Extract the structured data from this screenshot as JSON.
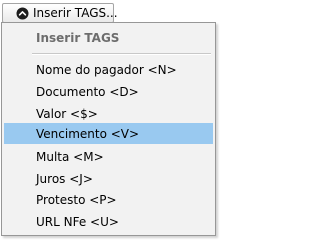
{
  "trigger": {
    "label": "Inserir TAGS...",
    "icon": "chevron-up-circle-icon"
  },
  "menu": {
    "header": "Inserir TAGS",
    "items": [
      {
        "label": "Nome do pagador <N>",
        "selected": false
      },
      {
        "label": "Documento <D>",
        "selected": false
      },
      {
        "label": "Valor <$>",
        "selected": false
      },
      {
        "label": "Vencimento <V>",
        "selected": true
      },
      {
        "label": "Multa <M>",
        "selected": false
      },
      {
        "label": "Juros <J>",
        "selected": false
      },
      {
        "label": "Protesto <P>",
        "selected": false
      },
      {
        "label": "URL NFe <U>",
        "selected": false
      }
    ]
  },
  "colors": {
    "selected_bg": "#99c9f0",
    "menu_bg": "#f2f2f2",
    "header_text": "#6d6d6d",
    "icon_fill": "#1d1d1d"
  }
}
